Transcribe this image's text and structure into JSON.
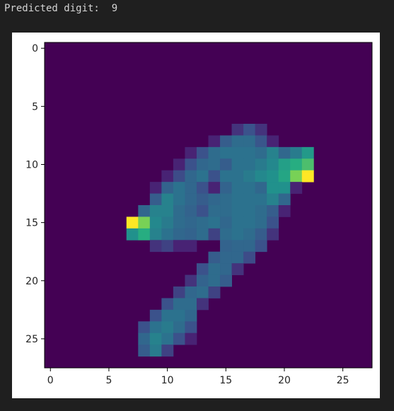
{
  "output": {
    "prefix": "Predicted digit:",
    "digit": "9"
  },
  "chart_data": {
    "type": "heatmap",
    "colormap": "viridis",
    "shape": [
      28,
      28
    ],
    "value_range": [
      0,
      1
    ],
    "x_ticks": [
      0,
      5,
      10,
      15,
      20,
      25
    ],
    "y_ticks": [
      0,
      5,
      10,
      15,
      20,
      25
    ],
    "grid": false,
    "pixels": [
      [
        16,
        7,
        0.2
      ],
      [
        17,
        7,
        0.3
      ],
      [
        18,
        7,
        0.2
      ],
      [
        14,
        8,
        0.15
      ],
      [
        15,
        8,
        0.35
      ],
      [
        16,
        8,
        0.42
      ],
      [
        17,
        8,
        0.42
      ],
      [
        18,
        8,
        0.32
      ],
      [
        19,
        8,
        0.15
      ],
      [
        12,
        9,
        0.15
      ],
      [
        13,
        9,
        0.3
      ],
      [
        14,
        9,
        0.42
      ],
      [
        15,
        9,
        0.45
      ],
      [
        16,
        9,
        0.45
      ],
      [
        17,
        9,
        0.45
      ],
      [
        18,
        9,
        0.42
      ],
      [
        19,
        9,
        0.5
      ],
      [
        20,
        9,
        0.4
      ],
      [
        21,
        9,
        0.48
      ],
      [
        22,
        9,
        0.58
      ],
      [
        11,
        10,
        0.15
      ],
      [
        12,
        10,
        0.3
      ],
      [
        13,
        10,
        0.4
      ],
      [
        14,
        10,
        0.42
      ],
      [
        15,
        10,
        0.35
      ],
      [
        16,
        10,
        0.45
      ],
      [
        17,
        10,
        0.45
      ],
      [
        18,
        10,
        0.48
      ],
      [
        19,
        10,
        0.52
      ],
      [
        20,
        10,
        0.6
      ],
      [
        21,
        10,
        0.65
      ],
      [
        22,
        10,
        0.72
      ],
      [
        10,
        11,
        0.15
      ],
      [
        11,
        11,
        0.28
      ],
      [
        12,
        11,
        0.4
      ],
      [
        13,
        11,
        0.45
      ],
      [
        14,
        11,
        0.3
      ],
      [
        15,
        11,
        0.45
      ],
      [
        16,
        11,
        0.45
      ],
      [
        17,
        11,
        0.48
      ],
      [
        18,
        11,
        0.52
      ],
      [
        19,
        11,
        0.55
      ],
      [
        20,
        11,
        0.62
      ],
      [
        21,
        11,
        0.8
      ],
      [
        22,
        11,
        1.0
      ],
      [
        9,
        12,
        0.15
      ],
      [
        10,
        12,
        0.38
      ],
      [
        11,
        12,
        0.45
      ],
      [
        12,
        12,
        0.4
      ],
      [
        13,
        12,
        0.3
      ],
      [
        14,
        12,
        0.15
      ],
      [
        15,
        12,
        0.38
      ],
      [
        16,
        12,
        0.45
      ],
      [
        17,
        12,
        0.45
      ],
      [
        18,
        12,
        0.4
      ],
      [
        19,
        12,
        0.55
      ],
      [
        20,
        12,
        0.55
      ],
      [
        21,
        12,
        0.15
      ],
      [
        9,
        13,
        0.35
      ],
      [
        10,
        13,
        0.5
      ],
      [
        11,
        13,
        0.45
      ],
      [
        12,
        13,
        0.4
      ],
      [
        13,
        13,
        0.35
      ],
      [
        14,
        13,
        0.4
      ],
      [
        15,
        13,
        0.42
      ],
      [
        16,
        13,
        0.45
      ],
      [
        17,
        13,
        0.45
      ],
      [
        18,
        13,
        0.45
      ],
      [
        19,
        13,
        0.5
      ],
      [
        20,
        13,
        0.4
      ],
      [
        8,
        14,
        0.4
      ],
      [
        9,
        14,
        0.5
      ],
      [
        10,
        14,
        0.5
      ],
      [
        11,
        14,
        0.42
      ],
      [
        12,
        14,
        0.38
      ],
      [
        13,
        14,
        0.3
      ],
      [
        14,
        14,
        0.42
      ],
      [
        15,
        14,
        0.42
      ],
      [
        16,
        14,
        0.45
      ],
      [
        17,
        14,
        0.45
      ],
      [
        18,
        14,
        0.42
      ],
      [
        19,
        14,
        0.35
      ],
      [
        20,
        14,
        0.15
      ],
      [
        7,
        15,
        1.0
      ],
      [
        8,
        15,
        0.8
      ],
      [
        9,
        15,
        0.52
      ],
      [
        10,
        15,
        0.48
      ],
      [
        11,
        15,
        0.42
      ],
      [
        12,
        15,
        0.4
      ],
      [
        13,
        15,
        0.42
      ],
      [
        14,
        15,
        0.45
      ],
      [
        15,
        15,
        0.4
      ],
      [
        16,
        15,
        0.45
      ],
      [
        17,
        15,
        0.45
      ],
      [
        18,
        15,
        0.42
      ],
      [
        19,
        15,
        0.3
      ],
      [
        7,
        16,
        0.55
      ],
      [
        8,
        16,
        0.65
      ],
      [
        9,
        16,
        0.5
      ],
      [
        10,
        16,
        0.45
      ],
      [
        11,
        16,
        0.4
      ],
      [
        12,
        16,
        0.38
      ],
      [
        13,
        16,
        0.42
      ],
      [
        14,
        16,
        0.25
      ],
      [
        15,
        16,
        0.42
      ],
      [
        16,
        16,
        0.45
      ],
      [
        17,
        16,
        0.42
      ],
      [
        18,
        16,
        0.35
      ],
      [
        19,
        16,
        0.2
      ],
      [
        9,
        17,
        0.2
      ],
      [
        10,
        17,
        0.25
      ],
      [
        11,
        17,
        0.15
      ],
      [
        12,
        17,
        0.15
      ],
      [
        15,
        17,
        0.38
      ],
      [
        16,
        17,
        0.4
      ],
      [
        17,
        17,
        0.4
      ],
      [
        18,
        17,
        0.3
      ],
      [
        14,
        18,
        0.35
      ],
      [
        15,
        18,
        0.4
      ],
      [
        16,
        18,
        0.4
      ],
      [
        17,
        18,
        0.28
      ],
      [
        13,
        19,
        0.3
      ],
      [
        14,
        19,
        0.42
      ],
      [
        15,
        19,
        0.4
      ],
      [
        16,
        19,
        0.2
      ],
      [
        12,
        20,
        0.2
      ],
      [
        13,
        20,
        0.38
      ],
      [
        14,
        20,
        0.42
      ],
      [
        15,
        20,
        0.35
      ],
      [
        11,
        21,
        0.25
      ],
      [
        12,
        21,
        0.4
      ],
      [
        13,
        21,
        0.42
      ],
      [
        14,
        21,
        0.25
      ],
      [
        10,
        22,
        0.3
      ],
      [
        11,
        22,
        0.42
      ],
      [
        12,
        22,
        0.42
      ],
      [
        13,
        22,
        0.2
      ],
      [
        9,
        23,
        0.3
      ],
      [
        10,
        23,
        0.45
      ],
      [
        11,
        23,
        0.45
      ],
      [
        12,
        23,
        0.4
      ],
      [
        8,
        24,
        0.3
      ],
      [
        9,
        24,
        0.45
      ],
      [
        10,
        24,
        0.48
      ],
      [
        11,
        24,
        0.42
      ],
      [
        12,
        24,
        0.3
      ],
      [
        8,
        25,
        0.4
      ],
      [
        9,
        25,
        0.5
      ],
      [
        10,
        25,
        0.45
      ],
      [
        11,
        25,
        0.3
      ],
      [
        12,
        25,
        0.15
      ],
      [
        8,
        26,
        0.35
      ],
      [
        9,
        26,
        0.48
      ],
      [
        10,
        26,
        0.25
      ]
    ]
  }
}
